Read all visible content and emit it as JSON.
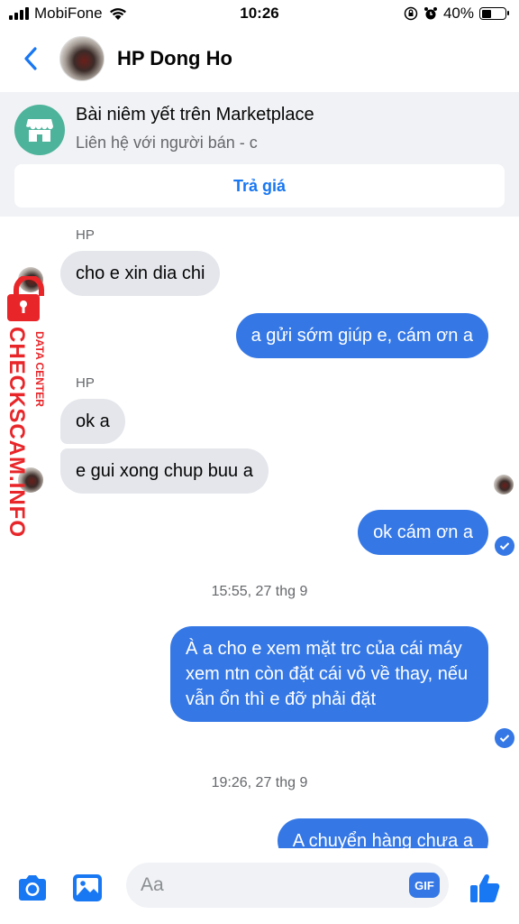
{
  "status_bar": {
    "carrier": "MobiFone",
    "time": "10:26",
    "battery": "40%",
    "battery_level": 0.4
  },
  "header": {
    "title": "HP Dong Ho"
  },
  "marketplace": {
    "title": "Bài niêm yết trên Marketplace",
    "subtitle": "Liên hệ với người bán - c",
    "offer_button": "Trả giá"
  },
  "messages": [
    {
      "type": "sender",
      "text": "HP"
    },
    {
      "type": "in",
      "text": "cho e xin dia chi"
    },
    {
      "type": "out",
      "text": "a gửi sớm giúp e, cám ơn a"
    },
    {
      "type": "sender",
      "text": "HP"
    },
    {
      "type": "in",
      "text": "ok a"
    },
    {
      "type": "in",
      "text": "e gui xong chup buu a"
    },
    {
      "type": "out",
      "text": "ok cám ơn a"
    },
    {
      "type": "time",
      "text": "15:55, 27 thg 9"
    },
    {
      "type": "out",
      "text": "À a cho e xem mặt trc của cái máy xem ntn còn đặt cái vỏ về thay, nếu vẫn ổn thì e đỡ phải đặt"
    },
    {
      "type": "time",
      "text": "19:26, 27 thg 9"
    },
    {
      "type": "out",
      "text": "A chuyển hàng chưa a"
    }
  ],
  "watermark": {
    "brand": "CHECKSCAM.INFO",
    "tag": "DATA CENTER"
  },
  "composer": {
    "placeholder": "Aa",
    "gif_label": "GIF"
  },
  "colors": {
    "accent": "#3578e5",
    "incoming_bubble": "#e4e6eb",
    "marketplace_icon": "#4db39a",
    "watermark": "#e8262a"
  },
  "icons": [
    "wifi-icon",
    "lock-rotation-icon",
    "alarm-icon",
    "back-chevron-icon",
    "store-icon",
    "camera-icon",
    "photo-icon",
    "gif-icon",
    "thumbs-up-icon",
    "seen-check-icon"
  ]
}
